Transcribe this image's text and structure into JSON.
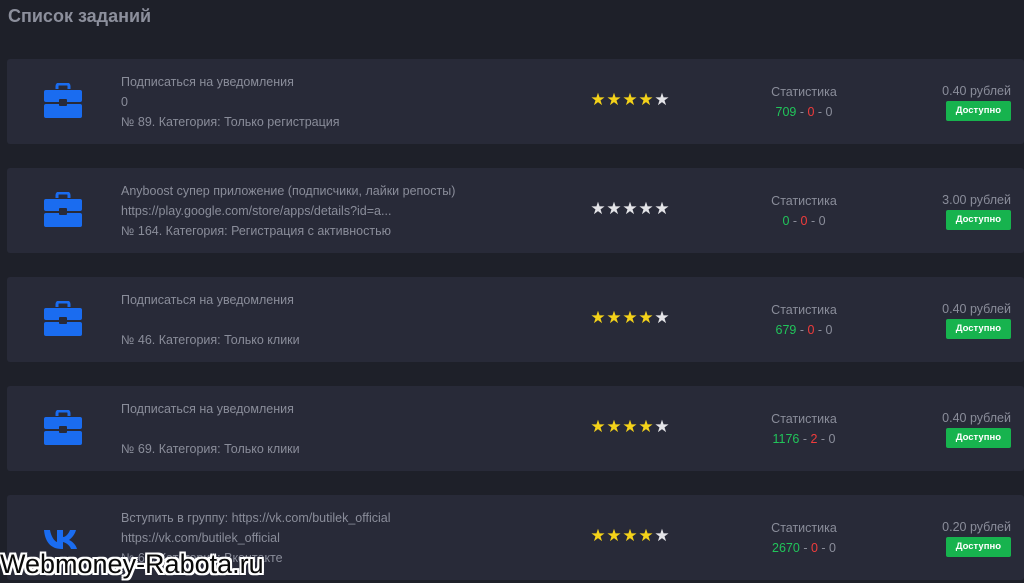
{
  "page": {
    "title": "Список заданий",
    "watermark": "Webmoney-Rabota.ru"
  },
  "colors": {
    "accent_blue": "#1a6cf0",
    "available_green": "#17b34e",
    "star_on": "#f4d21a",
    "star_off": "#e4e4e8",
    "stat_green": "#21c45a",
    "stat_red": "#f03c3c"
  },
  "tasks": [
    {
      "icon": "briefcase-icon",
      "title": "Подписаться на уведомления",
      "subtitle": "0",
      "meta": "№ 89. Категория: Только регистрация",
      "rating": 4,
      "stats_label": "Статистика",
      "stat_done": "709",
      "stat_rejected": "0",
      "stat_pending": "0",
      "price": "0.40 рублей",
      "status": "Доступно"
    },
    {
      "icon": "briefcase-icon",
      "title": "Anyboost супер приложение (подписчики, лайки репосты)",
      "subtitle": "https://play.google.com/store/apps/details?id=a...",
      "meta": "№ 164. Категория: Регистрация с активностью",
      "rating": 0,
      "stats_label": "Статистика",
      "stat_done": "0",
      "stat_rejected": "0",
      "stat_pending": "0",
      "price": "3.00 рублей",
      "status": "Доступно"
    },
    {
      "icon": "briefcase-icon",
      "title": "Подписаться на уведомления",
      "subtitle": "",
      "meta": "№ 46. Категория: Только клики",
      "rating": 4,
      "stats_label": "Статистика",
      "stat_done": "679",
      "stat_rejected": "0",
      "stat_pending": "0",
      "price": "0.40 рублей",
      "status": "Доступно"
    },
    {
      "icon": "briefcase-icon",
      "title": "Подписаться на уведомления",
      "subtitle": "",
      "meta": "№ 69. Категория: Только клики",
      "rating": 4,
      "stats_label": "Статистика",
      "stat_done": "1176",
      "stat_rejected": "2",
      "stat_pending": "0",
      "price": "0.40 рублей",
      "status": "Доступно"
    },
    {
      "icon": "vk-icon",
      "title": "Вступить в группу: https://vk.com/butilek_official",
      "subtitle": "https://vk.com/butilek_official",
      "meta": "№ 64. Категория: Вконтакте",
      "rating": 4,
      "stats_label": "Статистика",
      "stat_done": "2670",
      "stat_rejected": "0",
      "stat_pending": "0",
      "price": "0.20 рублей",
      "status": "Доступно"
    }
  ]
}
